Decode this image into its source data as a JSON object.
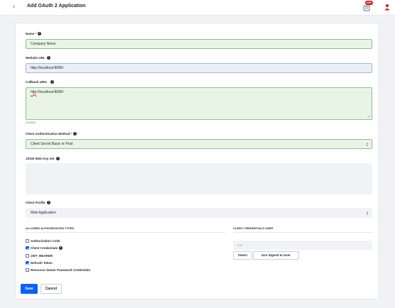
{
  "header": {
    "title": "Add OAuth 2 Application",
    "back_icon": "chevron-left-icon",
    "notification_badge": "199+",
    "colors": {
      "badge": "#da1414",
      "user_icon": "#da1414"
    }
  },
  "form": {
    "name": {
      "label": "Name",
      "required_mark": "*",
      "value": "Company News"
    },
    "website_url": {
      "label": "Website URL",
      "value": "http://localhost:8080/"
    },
    "callback_uris": {
      "label": "Callback URIs",
      "value_prefix": "http",
      "value_rest": "://localhost:8080/",
      "counter": "22/4000"
    },
    "client_auth_method": {
      "label": "Client Authentication Method",
      "required_mark": "*",
      "selected": "Client Secret Basic or Post"
    },
    "jwks": {
      "label": "JSON Web Key Set",
      "value": ""
    },
    "client_profile": {
      "label": "Client Profile",
      "selected": "Web Application"
    }
  },
  "allowed_types": {
    "heading": "ALLOWED AUTHORIZATION TYPES",
    "items": [
      {
        "label": "Authorization Code",
        "checked": false,
        "info": false
      },
      {
        "label": "Client Credentials",
        "checked": true,
        "info": true
      },
      {
        "label": "JWT_BEARER",
        "checked": false,
        "info": false
      },
      {
        "label": "Refresh Token",
        "checked": true,
        "info": false
      },
      {
        "label": "Resource Owner Password Credentials",
        "checked": false,
        "info": false
      }
    ]
  },
  "client_credentials_user": {
    "heading": "CLIENT CREDENTIALS USER",
    "value": "test",
    "select_label": "Select",
    "use_signed_in_label": "Use Signed In User"
  },
  "actions": {
    "save_label": "Save",
    "cancel_label": "Cancel"
  },
  "colors": {
    "primary": "#0b5fff",
    "valid_field_bg": "#e8f5e6",
    "valid_field_border": "#8ac286",
    "autofill_bg": "#e9eef8"
  }
}
